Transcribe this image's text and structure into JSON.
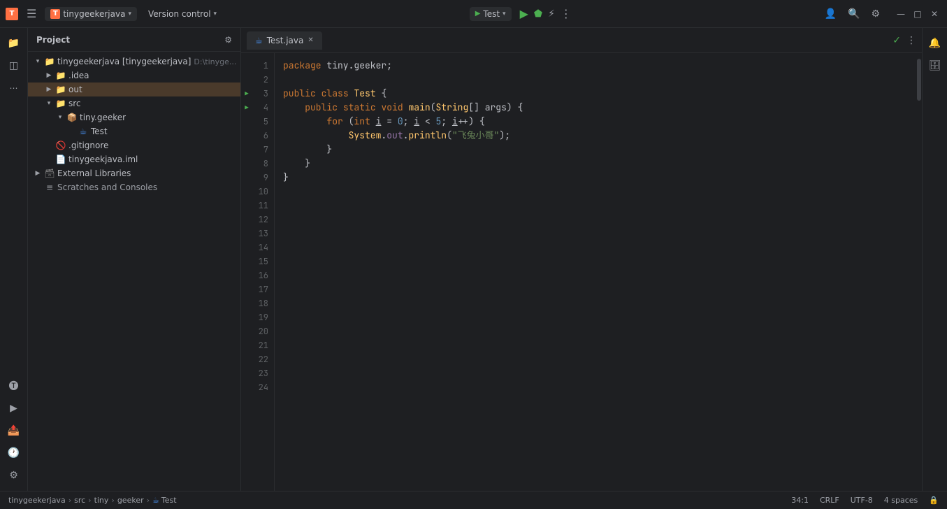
{
  "titlebar": {
    "app_icon": "T",
    "menu_icon": "☰",
    "project_name": "tinygeekerjava",
    "project_label": "T",
    "version_control": "Version control",
    "run_config": "Test",
    "run_icon": "▶",
    "debug_icon": "🐞",
    "profile_icon": "👤",
    "search_icon": "🔍",
    "settings_icon": "⚙",
    "more_icon": "⋯",
    "minimize": "—",
    "maximize": "□",
    "close": "✕",
    "chevron_down": "▾"
  },
  "sidebar": {
    "project_icon": "📁",
    "structure_icon": "◫",
    "more_icon": "⋯",
    "learn_icon": "🎓",
    "run_icon": "▶",
    "commit_icon": "📤",
    "history_icon": "🕐",
    "settings_icon": "⚙"
  },
  "project_panel": {
    "title": "Project",
    "gear_icon": "⚙",
    "root_item": "tinygeekerjava [tinygeekerjava]",
    "root_path": "D:\\tinyge...",
    "idea_folder": ".idea",
    "out_folder": "out",
    "src_folder": "src",
    "tiny_geeker_folder": "tiny.geeker",
    "test_file": "Test",
    "gitignore_file": ".gitignore",
    "iml_file": "tinygeekjava.iml",
    "external_libraries": "External Libraries",
    "scratches_consoles": "Scratches and Consoles"
  },
  "editor": {
    "tab_label": "Test.java",
    "tab_icon": "☕",
    "more_tabs_icon": "⋮",
    "checkmark": "✓",
    "lines": [
      {
        "num": 1,
        "content": "package tiny.geeker;",
        "run": false
      },
      {
        "num": 2,
        "content": "",
        "run": false
      },
      {
        "num": 3,
        "content": "public class Test {",
        "run": true
      },
      {
        "num": 4,
        "content": "    public static void main(String[] args) {",
        "run": true
      },
      {
        "num": 5,
        "content": "        for (int i = 0; i < 5; i++) {",
        "run": false
      },
      {
        "num": 6,
        "content": "            System.out.println(\"飞兔小哥\");",
        "run": false
      },
      {
        "num": 7,
        "content": "        }",
        "run": false
      },
      {
        "num": 8,
        "content": "    }",
        "run": false
      },
      {
        "num": 9,
        "content": "}",
        "run": false
      },
      {
        "num": 10,
        "content": "",
        "run": false
      },
      {
        "num": 11,
        "content": "",
        "run": false
      },
      {
        "num": 12,
        "content": "",
        "run": false
      },
      {
        "num": 13,
        "content": "",
        "run": false
      },
      {
        "num": 14,
        "content": "",
        "run": false
      },
      {
        "num": 15,
        "content": "",
        "run": false
      },
      {
        "num": 16,
        "content": "",
        "run": false
      },
      {
        "num": 17,
        "content": "",
        "run": false
      },
      {
        "num": 18,
        "content": "",
        "run": false
      },
      {
        "num": 19,
        "content": "",
        "run": false
      },
      {
        "num": 20,
        "content": "",
        "run": false
      },
      {
        "num": 21,
        "content": "",
        "run": false
      },
      {
        "num": 22,
        "content": "",
        "run": false
      },
      {
        "num": 23,
        "content": "",
        "run": false
      },
      {
        "num": 24,
        "content": "",
        "run": false
      }
    ]
  },
  "statusbar": {
    "breadcrumbs": [
      "tinygeekerjava",
      "src",
      "tiny",
      "geeker",
      "Test"
    ],
    "position": "34:1",
    "line_ending": "CRLF",
    "encoding": "UTF-8",
    "indent": "4 spaces",
    "lock_icon": "🔒"
  }
}
